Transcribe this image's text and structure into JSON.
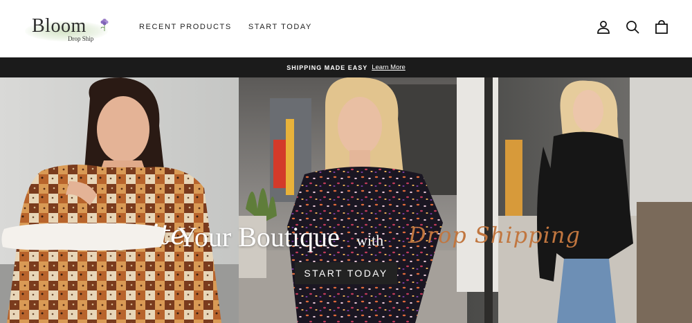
{
  "header": {
    "logo": {
      "word": "Bloom",
      "sub": "Drop Ship"
    },
    "nav": [
      {
        "label": "RECENT PRODUCTS"
      },
      {
        "label": "START TODAY"
      }
    ],
    "icons": [
      "account-icon",
      "search-icon",
      "cart-icon"
    ]
  },
  "announcement": {
    "message": "SHIPPING MADE EASY",
    "link_label": "Learn More"
  },
  "hero": {
    "headline_ignite": "Ignite",
    "headline_main": "Your Boutique",
    "headline_with": "with",
    "headline_accent": "Drop Shipping",
    "cta_label": "START TODAY",
    "accent_color": "#c1763f"
  },
  "colors": {
    "announcement_bg": "#1b1b1b",
    "cta_bg": "#222222"
  }
}
